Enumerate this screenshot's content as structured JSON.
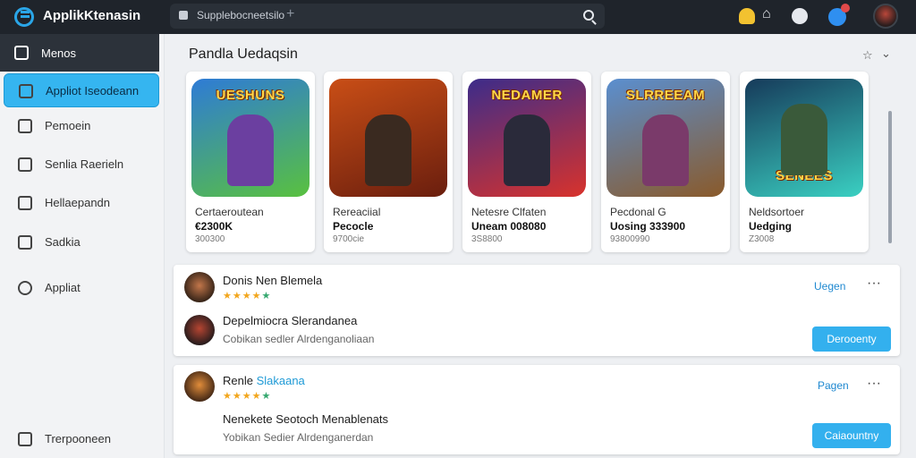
{
  "topbar": {
    "app_title": "ApplikKtenasin",
    "url": "Supplebocneetsilo",
    "plus": "+",
    "home_glyph": "⌂"
  },
  "sidebar": {
    "items": [
      {
        "label": "Menos"
      },
      {
        "label": "Appliot Iseodeann"
      },
      {
        "label": "Pemoein"
      },
      {
        "label": "Senlia Raerieln"
      },
      {
        "label": "Hellaepandn"
      },
      {
        "label": "Sadkia"
      },
      {
        "label": "Appliat"
      },
      {
        "label": "Trerpooneen"
      }
    ]
  },
  "main": {
    "title": "Pandla Uedaqsin",
    "pin_glyph": "☆",
    "chev_glyph": "⌄",
    "games": [
      {
        "banner": "UESHUNS",
        "name": "Certaeroutean",
        "price": "€2300K",
        "sub": "300300",
        "colors": [
          "#2e7bd6",
          "#59c13f"
        ]
      },
      {
        "banner": "",
        "name": "Rereaciial",
        "price": "Pecocle",
        "sub": "9700cie",
        "colors": [
          "#c94e16",
          "#6a1e0e"
        ]
      },
      {
        "banner": "NEDAMER",
        "name": "Netesre Clfaten",
        "price": "Uneam 008080",
        "sub": "3S8800",
        "colors": [
          "#3c2c8a",
          "#d8322c"
        ]
      },
      {
        "banner": "SLRREEAM",
        "name": "Pecdonal G",
        "price": "Uosing 333900",
        "sub": "93800990",
        "colors": [
          "#5a8fd0",
          "#8a5a2a"
        ]
      },
      {
        "banner": "SENEES",
        "name": "Neldsortoer",
        "price": "Uedging",
        "sub": "Z3008",
        "colors": [
          "#163a5a",
          "#3ad0c2"
        ]
      }
    ]
  },
  "panels": [
    {
      "title": "Donis Nen Blemela",
      "stars": "★★★★",
      "star_extra": "★",
      "link": "Uegen",
      "dots": "···",
      "subtitle": "Depelmiocra Slerandanea",
      "description": "Cobikan sedler Alrdenganoliaan",
      "button": "Derooenty"
    },
    {
      "title_plain": "Renle ",
      "title_highlight": "Slakaana",
      "stars": "★★★★",
      "star_extra": "★",
      "link": "Pagen",
      "dots": "···",
      "subtitle": "Nenekete Seotoch Menablenats",
      "description": "Yobikan Sedier Alrdenganerdan",
      "button": "Caiaountny"
    }
  ]
}
